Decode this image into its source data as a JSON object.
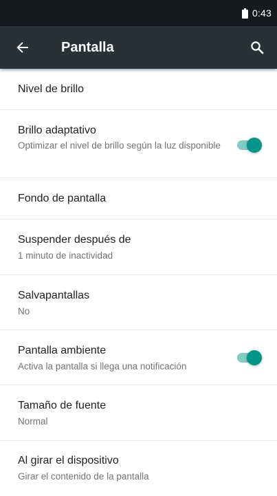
{
  "status_bar": {
    "time": "0:43",
    "battery_icon": "battery-full-icon"
  },
  "toolbar": {
    "title": "Pantalla",
    "back_icon": "arrow-back-icon",
    "search_icon": "search-icon"
  },
  "colors": {
    "status_bar": "#141a1e",
    "toolbar": "#263238",
    "accent": "#009688",
    "accent_track": "#80cbc4"
  },
  "settings": [
    {
      "title": "Nivel de brillo",
      "summary": ""
    },
    {
      "title": "Brillo adaptativo",
      "summary": "Optimizar el nivel de brillo según la luz disponible",
      "toggle": true,
      "toggle_on": true
    },
    {
      "title": "Fondo de pantalla",
      "summary": ""
    },
    {
      "title": "Suspender después de",
      "summary": "1 minuto de inactividad"
    },
    {
      "title": "Salvapantallas",
      "summary": "No"
    },
    {
      "title": "Pantalla ambiente",
      "summary": "Activa la pantalla si llega una notificación",
      "toggle": true,
      "toggle_on": true
    },
    {
      "title": "Tamaño de fuente",
      "summary": "Normal"
    },
    {
      "title": "Al girar el dispositivo",
      "summary": "Girar el contenido de la pantalla"
    }
  ]
}
